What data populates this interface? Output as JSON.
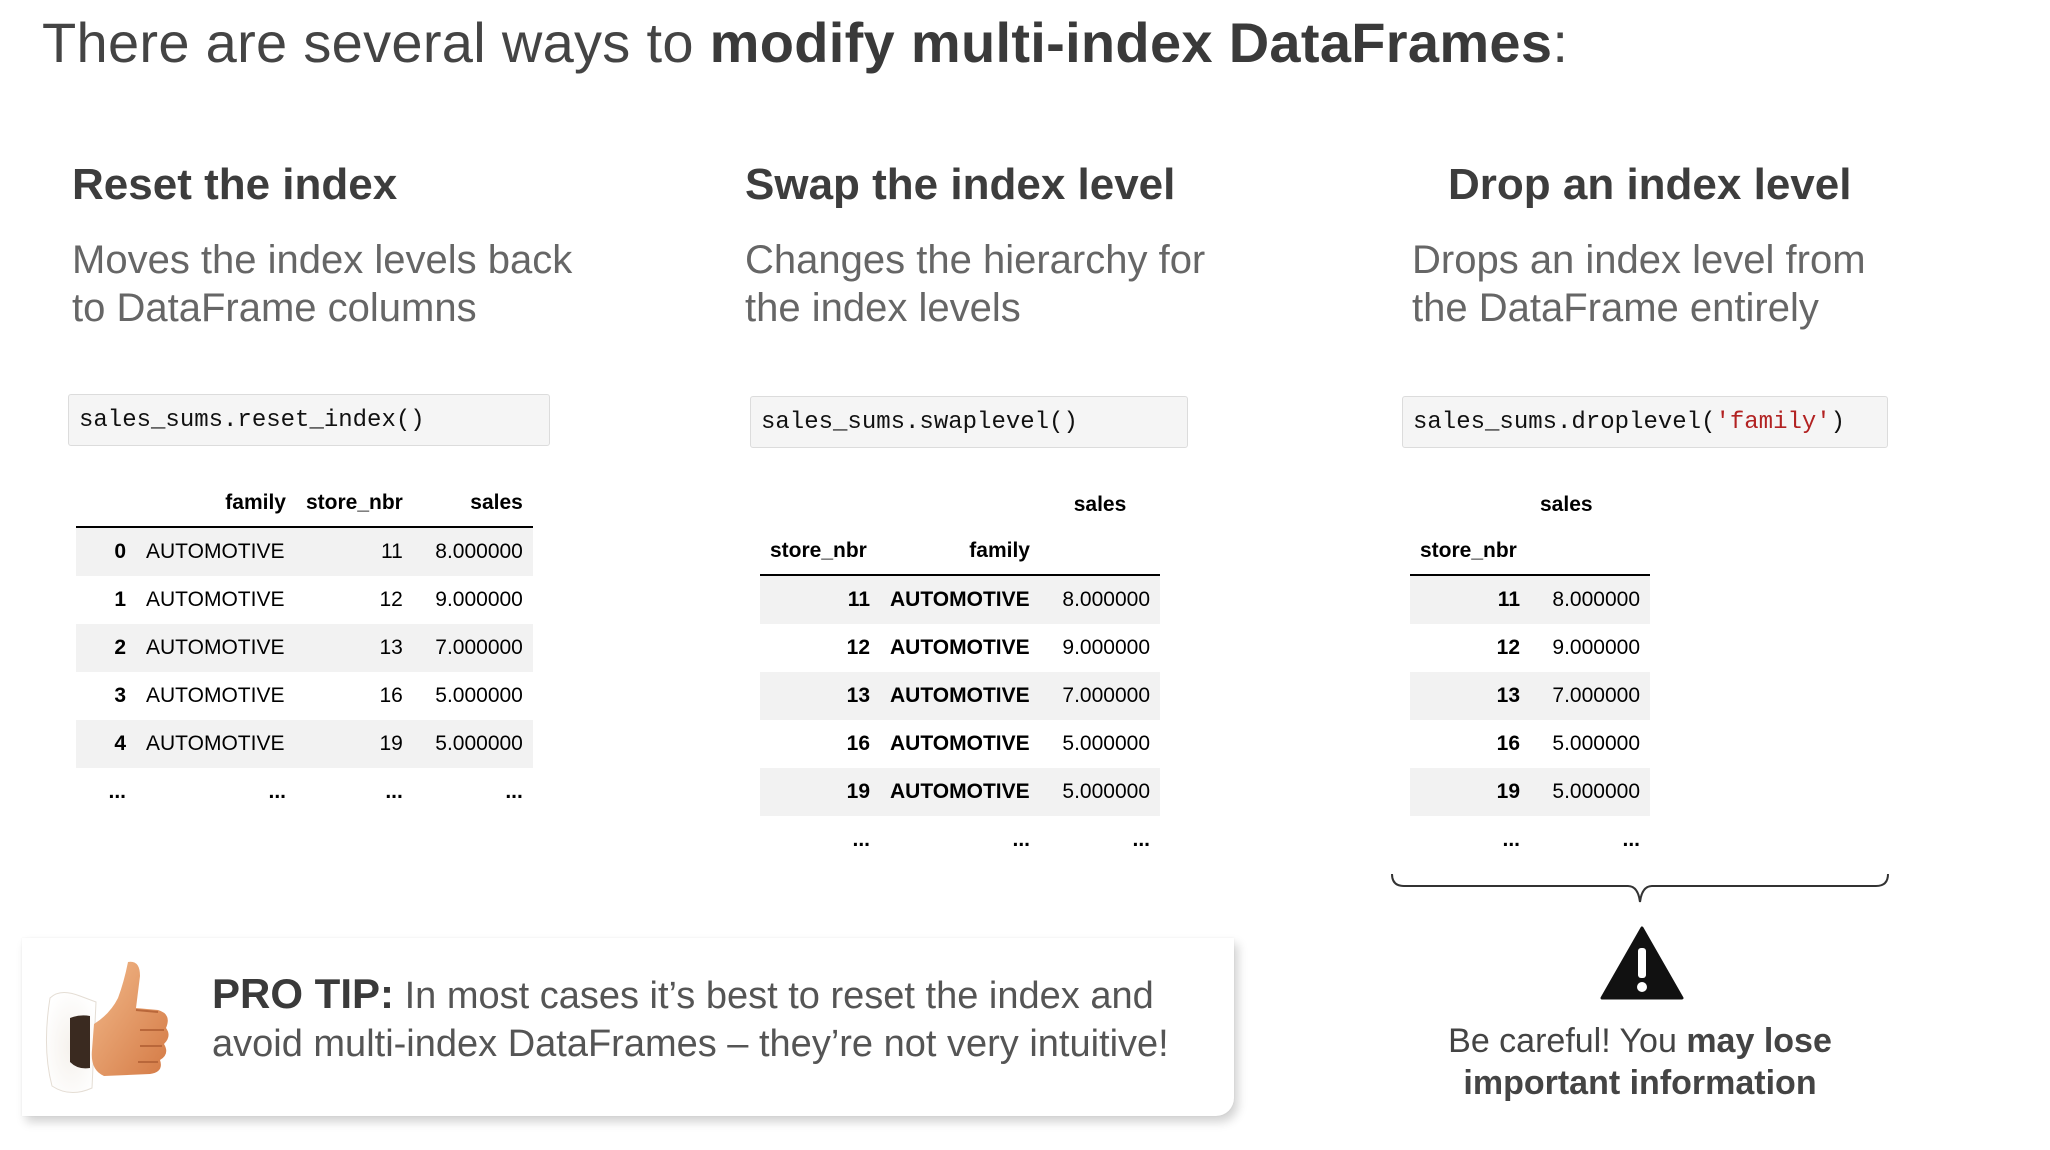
{
  "title": {
    "lead": "There are several ways to ",
    "bold": "modify multi-index DataFrames",
    "tail": ":"
  },
  "columns": [
    {
      "heading": "Reset the index",
      "desc_line1": "Moves the index levels back",
      "desc_line2": "to DataFrame columns",
      "code": "sales_sums.reset_index()"
    },
    {
      "heading": "Swap the index level",
      "desc_line1": "Changes the hierarchy for",
      "desc_line2": "the index levels",
      "code": "sales_sums.swaplevel()"
    },
    {
      "heading": "Drop an index level",
      "desc_line1": "Drops an index level from",
      "desc_line2": "the DataFrame entirely",
      "code_prefix": "sales_sums.droplevel(",
      "code_arg": "'family'",
      "code_suffix": ")"
    }
  ],
  "table1": {
    "headers": [
      "",
      "family",
      "store_nbr",
      "sales"
    ],
    "rows": [
      [
        "0",
        "AUTOMOTIVE",
        "11",
        "8.000000"
      ],
      [
        "1",
        "AUTOMOTIVE",
        "12",
        "9.000000"
      ],
      [
        "2",
        "AUTOMOTIVE",
        "13",
        "7.000000"
      ],
      [
        "3",
        "AUTOMOTIVE",
        "16",
        "5.000000"
      ],
      [
        "4",
        "AUTOMOTIVE",
        "19",
        "5.000000"
      ],
      [
        "...",
        "...",
        "...",
        "..."
      ]
    ]
  },
  "table2": {
    "top_header": "sales",
    "index_headers": [
      "store_nbr",
      "family"
    ],
    "rows": [
      [
        "11",
        "AUTOMOTIVE",
        "8.000000"
      ],
      [
        "12",
        "AUTOMOTIVE",
        "9.000000"
      ],
      [
        "13",
        "AUTOMOTIVE",
        "7.000000"
      ],
      [
        "16",
        "AUTOMOTIVE",
        "5.000000"
      ],
      [
        "19",
        "AUTOMOTIVE",
        "5.000000"
      ],
      [
        "...",
        "...",
        "..."
      ]
    ]
  },
  "table3": {
    "top_header": "sales",
    "index_header": "store_nbr",
    "rows": [
      [
        "11",
        "8.000000"
      ],
      [
        "12",
        "9.000000"
      ],
      [
        "13",
        "7.000000"
      ],
      [
        "16",
        "5.000000"
      ],
      [
        "19",
        "5.000000"
      ],
      [
        "...",
        "..."
      ]
    ]
  },
  "warning": {
    "icon": "warning-triangle-icon",
    "line1_normal": "Be careful! You ",
    "line1_bold": "may lose",
    "line2_bold": "important information"
  },
  "pro_tip": {
    "label": "PRO TIP:",
    "text1": " In most cases it’s best to reset the index and",
    "text2": "avoid multi-index DataFrames – they’re not very intuitive!",
    "icon": "thumbs-up-icon"
  },
  "colors": {
    "code_bg": "#f5f5f5",
    "string_red": "#b22222",
    "row_stripe": "#f2f2f2"
  }
}
